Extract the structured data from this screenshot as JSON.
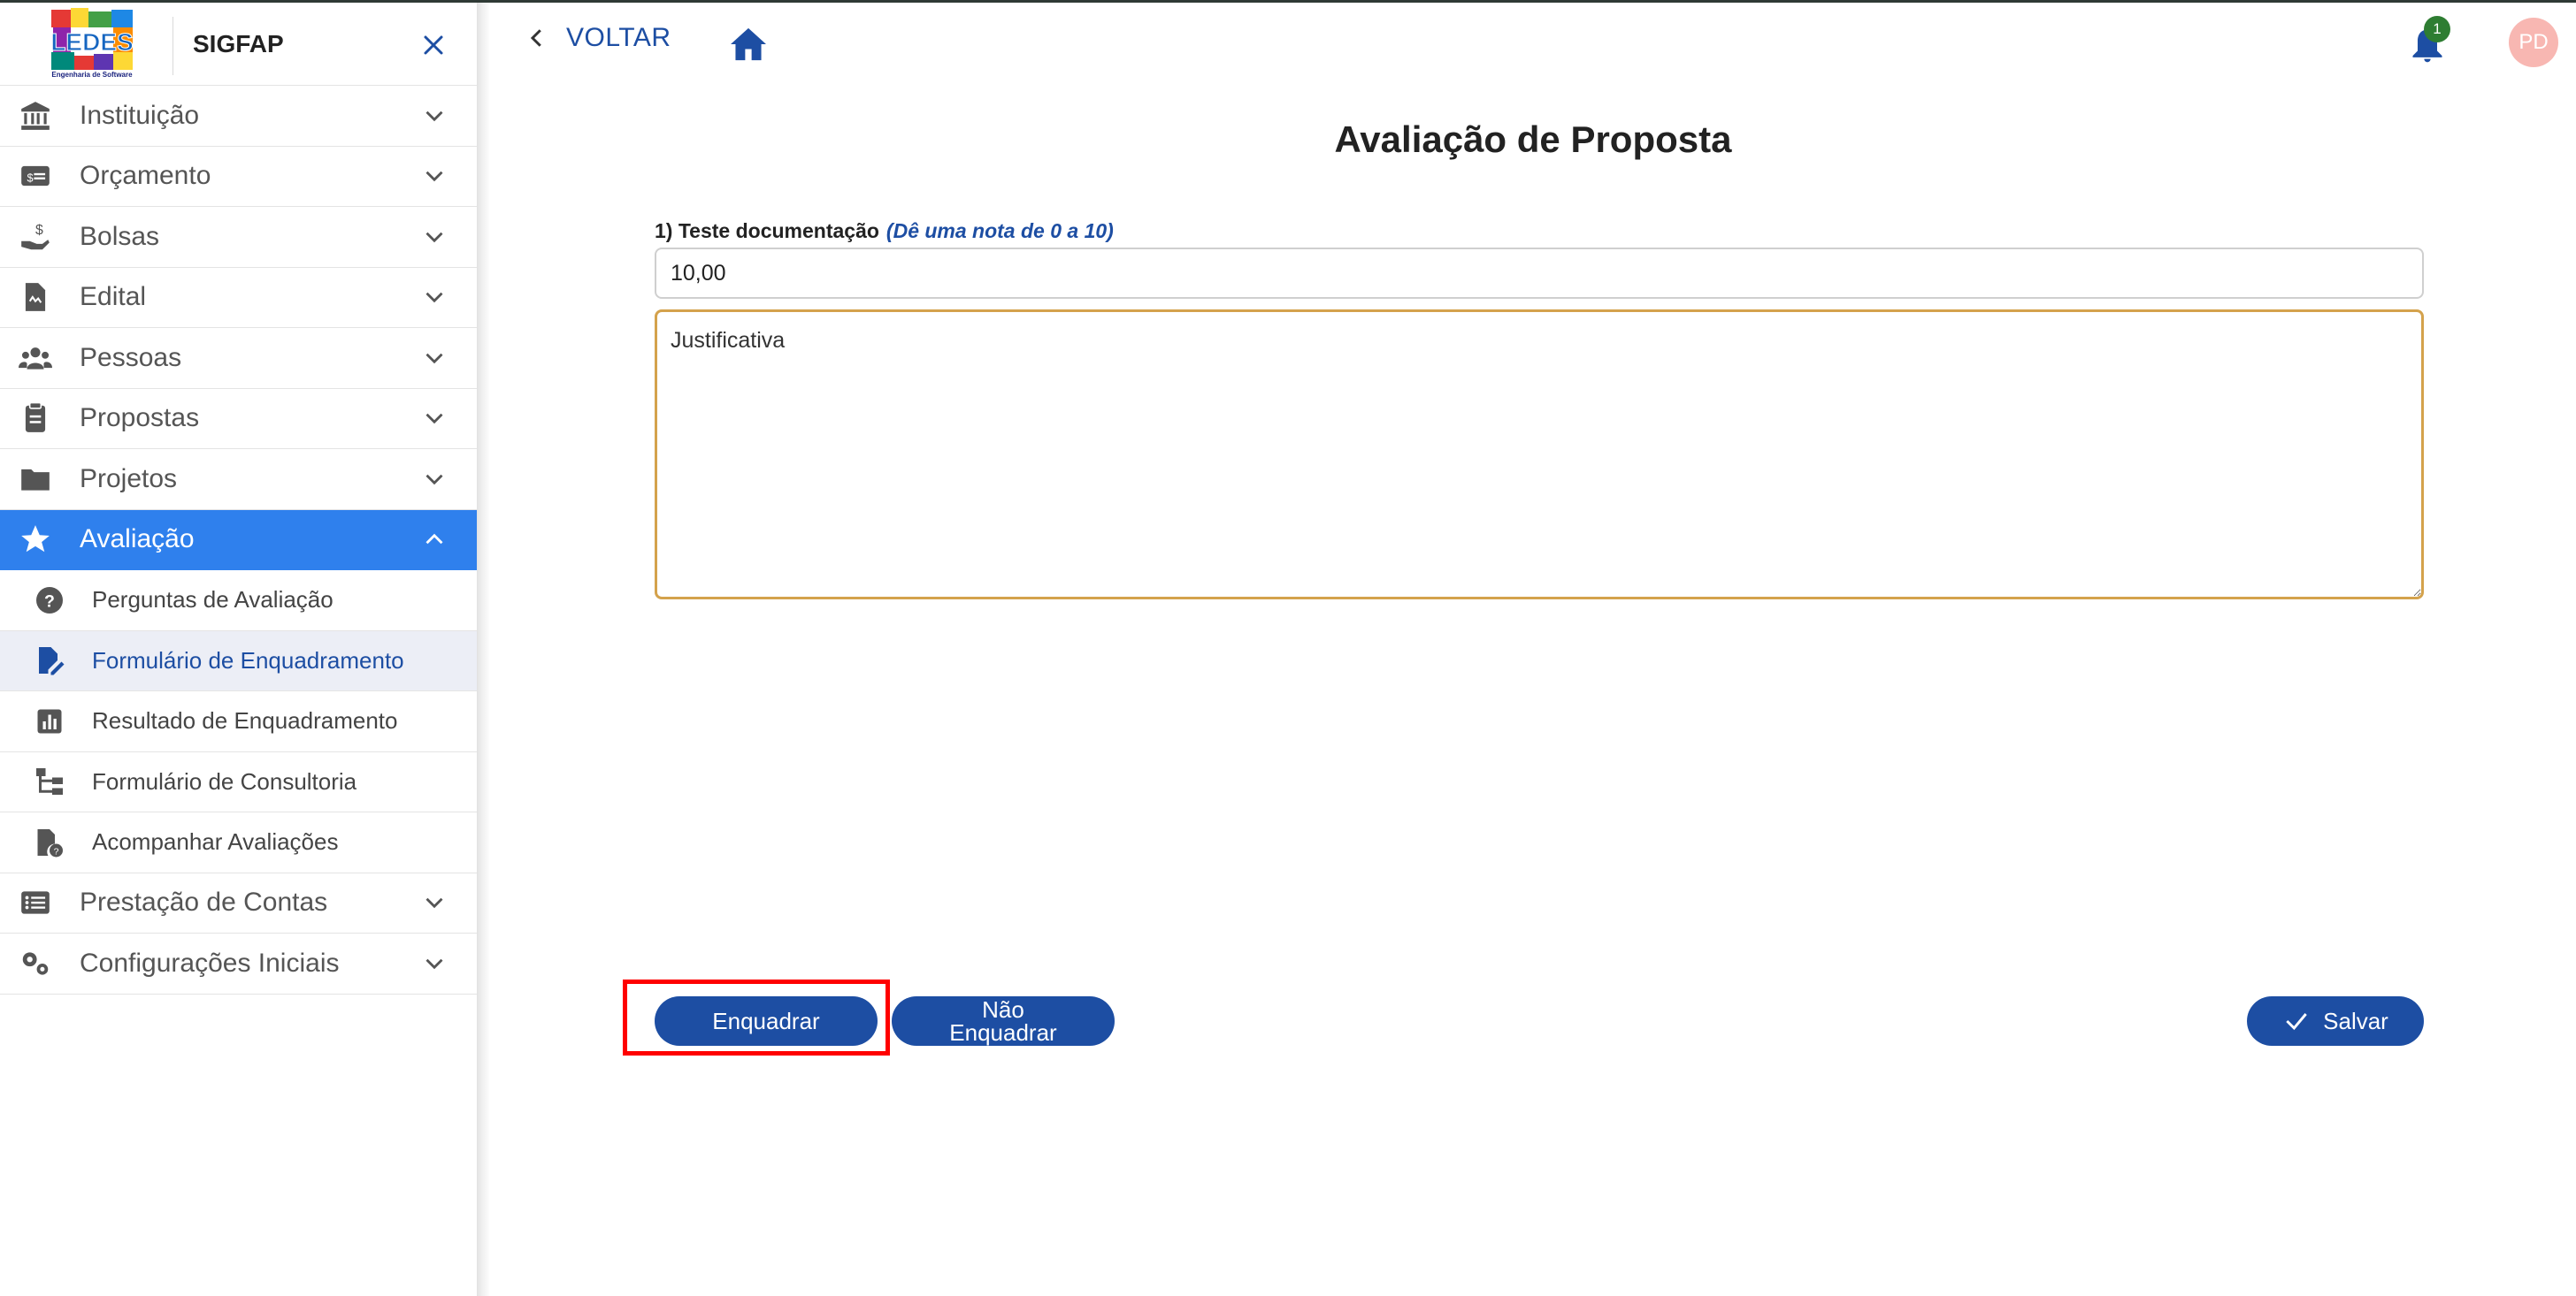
{
  "app": {
    "title": "SIGFAP",
    "logo_text": "LEDES",
    "logo_subtext": "Engenharia de Software"
  },
  "sidebar": {
    "items": [
      {
        "label": "Instituição",
        "icon": "bank-icon"
      },
      {
        "label": "Orçamento",
        "icon": "money-icon"
      },
      {
        "label": "Bolsas",
        "icon": "hand-coin-icon"
      },
      {
        "label": "Edital",
        "icon": "document-icon"
      },
      {
        "label": "Pessoas",
        "icon": "people-icon"
      },
      {
        "label": "Propostas",
        "icon": "clipboard-icon"
      },
      {
        "label": "Projetos",
        "icon": "folder-icon"
      },
      {
        "label": "Avaliação",
        "icon": "star-icon",
        "expanded": true
      }
    ],
    "sub_items": [
      {
        "label": "Perguntas de Avaliação",
        "icon": "question-circle-icon"
      },
      {
        "label": "Formulário de Enquadramento",
        "icon": "edit-document-icon",
        "selected": true
      },
      {
        "label": "Resultado de Enquadramento",
        "icon": "bar-chart-icon"
      },
      {
        "label": "Formulário de Consultoria",
        "icon": "tree-icon"
      },
      {
        "label": "Acompanhar Avaliações",
        "icon": "document-clock-icon"
      }
    ],
    "bottom_items": [
      {
        "label": "Prestação de Contas",
        "icon": "list-icon"
      },
      {
        "label": "Configurações Iniciais",
        "icon": "gears-icon"
      }
    ]
  },
  "topbar": {
    "back_label": "VOLTAR",
    "notification_count": "1",
    "avatar_initials": "PD"
  },
  "page": {
    "title": "Avaliação de Proposta"
  },
  "form": {
    "question_label": "1) Teste documentação",
    "question_hint": "(Dê uma nota de 0 a 10)",
    "score_value": "10,00",
    "justification_placeholder": "Justificativa",
    "justification_value": ""
  },
  "actions": {
    "enquadrar_label": "Enquadrar",
    "nao_enquadrar_label": "Não Enquadrar",
    "salvar_label": "Salvar"
  },
  "colors": {
    "primary": "#1d4ea3",
    "active_menu": "#2f80ed",
    "highlight": "#ff0000",
    "textarea_border": "#d4a24c",
    "badge": "#2e7d32",
    "avatar": "#f8b7b2"
  }
}
